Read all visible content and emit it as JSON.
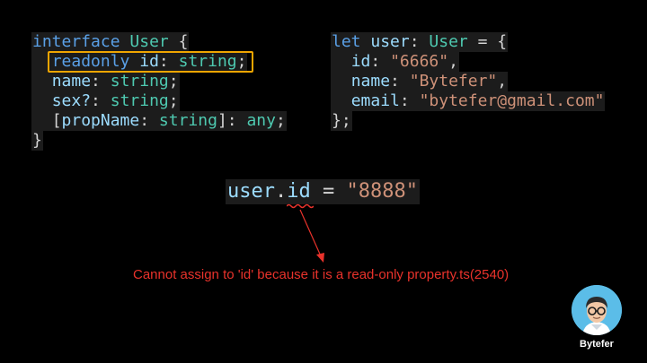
{
  "left_code": {
    "line1": {
      "kw": "interface",
      "sp": " ",
      "name": "User",
      "brace": " {"
    },
    "line2": {
      "indent": "  ",
      "kw": "readonly",
      "sp": " ",
      "prop": "id",
      "colon": ": ",
      "type": "string",
      "semi": ";"
    },
    "line3": {
      "indent": "  ",
      "prop": "name",
      "colon": ": ",
      "type": "string",
      "semi": ";"
    },
    "line4": {
      "indent": "  ",
      "prop": "sex?",
      "colon": ": ",
      "type": "string",
      "semi": ";"
    },
    "line5": {
      "indent": "  ",
      "open": "[",
      "prop": "propName",
      "colon": ": ",
      "type": "string",
      "close": "]: ",
      "type2": "any",
      "semi": ";"
    },
    "line6": {
      "brace": "}"
    }
  },
  "right_code": {
    "line1": {
      "kw": "let",
      "sp": " ",
      "var": "user",
      "colon": ": ",
      "type": "User",
      "eq": " = {"
    },
    "line2": {
      "indent": "  ",
      "prop": "id",
      "colon": ": ",
      "value": "\"6666\"",
      "comma": ","
    },
    "line3": {
      "indent": "  ",
      "prop": "name",
      "colon": ": ",
      "value": "\"Bytefer\"",
      "comma": ","
    },
    "line4": {
      "indent": "  ",
      "prop": "email",
      "colon": ": ",
      "value": "\"bytefer@gmail.com\""
    },
    "line5": {
      "close": "};"
    }
  },
  "assignment": {
    "obj": "user",
    "dot": ".",
    "prop": "id",
    "eq": " = ",
    "value": "\"8888\""
  },
  "error_message": "Cannot assign to 'id' because it is a read-only property.ts(2540)",
  "brand": {
    "name": "Bytefer"
  },
  "colors": {
    "keyword": "#5aa0e6",
    "type": "#4ec9b0",
    "property": "#9cdcfe",
    "string": "#ce9178",
    "error": "#e8322b",
    "highlight": "#f0a500",
    "avatar_bg": "#5bbde8"
  }
}
